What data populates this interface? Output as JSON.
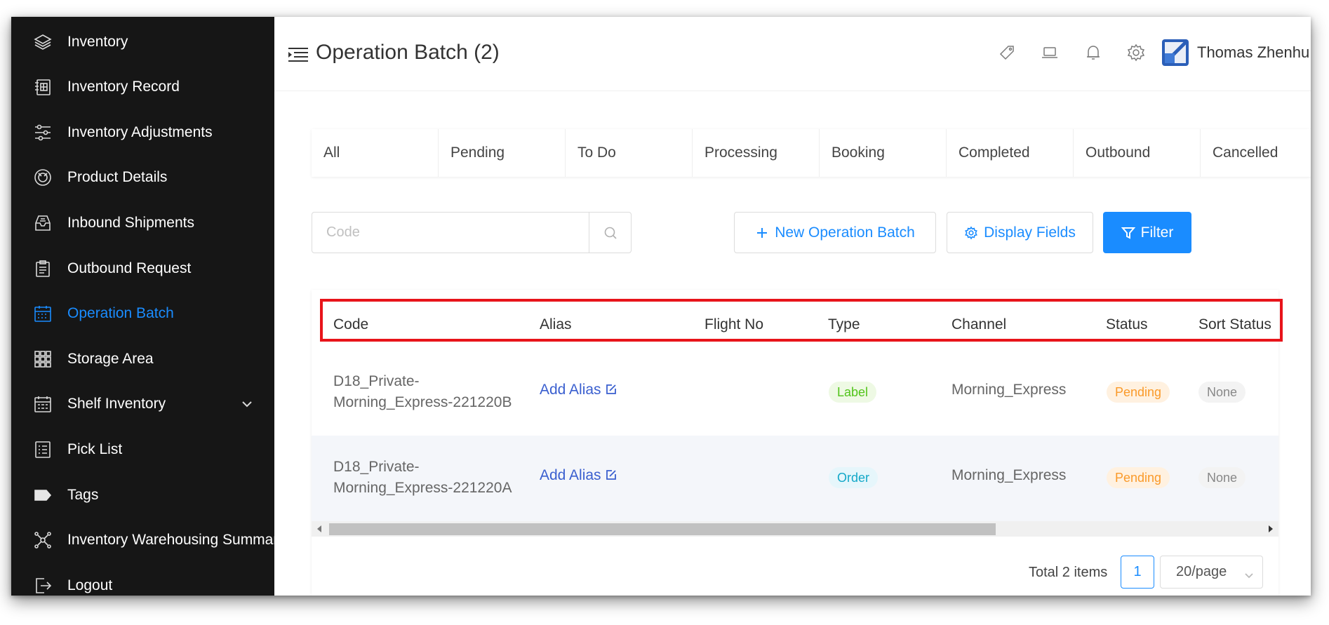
{
  "sidebar": {
    "items": [
      {
        "label": "Inventory",
        "icon": "layers-icon"
      },
      {
        "label": "Inventory Record",
        "icon": "ledger-icon"
      },
      {
        "label": "Inventory Adjustments",
        "icon": "sliders-icon"
      },
      {
        "label": "Product Details",
        "icon": "box-circle-icon"
      },
      {
        "label": "Inbound Shipments",
        "icon": "inbox-icon"
      },
      {
        "label": "Outbound Request",
        "icon": "clipboard-icon"
      },
      {
        "label": "Operation Batch",
        "icon": "calendar-icon"
      },
      {
        "label": "Storage Area",
        "icon": "grid-icon"
      },
      {
        "label": "Shelf Inventory",
        "icon": "shelf-calendar-icon"
      },
      {
        "label": "Pick List",
        "icon": "list-icon"
      },
      {
        "label": "Tags",
        "icon": "tag-icon"
      },
      {
        "label": "Inventory Warehousing Summary",
        "icon": "network-icon"
      },
      {
        "label": "Logout",
        "icon": "logout-icon"
      }
    ]
  },
  "header": {
    "title": "Operation Batch (2)",
    "user_name": "Thomas Zhenhu..",
    "icons": [
      "tag-outline-icon",
      "laptop-icon",
      "bell-icon",
      "gear-icon"
    ]
  },
  "tabs": [
    "All",
    "Pending",
    "To Do",
    "Processing",
    "Booking",
    "Completed",
    "Outbound",
    "Cancelled"
  ],
  "search": {
    "placeholder": "Code",
    "value": ""
  },
  "buttons": {
    "new_batch": "New Operation Batch",
    "display_fields": "Display Fields",
    "filter": "Filter"
  },
  "table": {
    "columns": [
      "Code",
      "Alias",
      "Flight No",
      "Type",
      "Channel",
      "Status",
      "Sort Status"
    ],
    "rows": [
      {
        "code_line1": "D18_Private-",
        "code_line2": "Morning_Express-221220B",
        "alias": "Add Alias",
        "flight_no": "",
        "type": "Label",
        "channel": "Morning_Express",
        "status": "Pending",
        "sort_status": "None"
      },
      {
        "code_line1": "D18_Private-",
        "code_line2": "Morning_Express-221220A",
        "alias": "Add Alias",
        "flight_no": "",
        "type": "Order",
        "channel": "Morning_Express",
        "status": "Pending",
        "sort_status": "None"
      }
    ]
  },
  "pagination": {
    "total": "Total 2 items",
    "current_page": "1",
    "page_size": "20/page"
  },
  "colors": {
    "accent": "#1a8cff",
    "sidebar_bg": "#161616",
    "highlight": "#e8141a",
    "pending": "#fa9a2a",
    "label_tag": "#52c41a",
    "order_tag": "#13a8c8"
  }
}
